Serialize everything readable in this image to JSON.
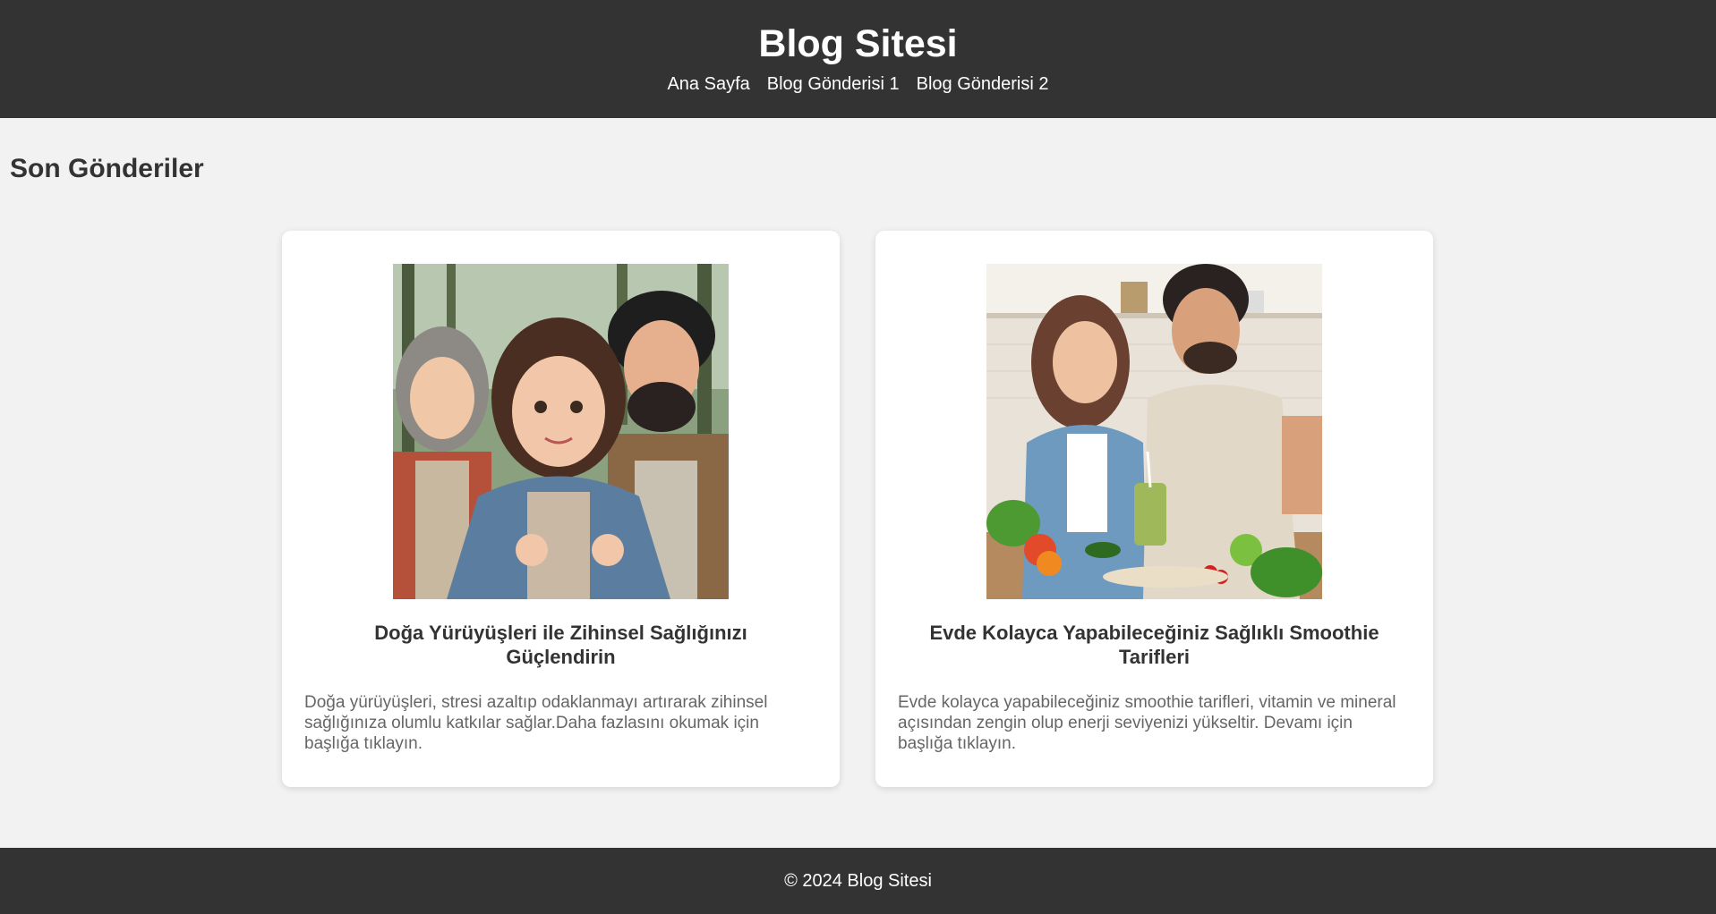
{
  "header": {
    "title": "Blog Sitesi",
    "nav": [
      {
        "label": "Ana Sayfa"
      },
      {
        "label": "Blog Gönderisi 1"
      },
      {
        "label": "Blog Gönderisi 2"
      }
    ]
  },
  "main": {
    "section_title": "Son Gönderiler",
    "posts": [
      {
        "title": "Doğa Yürüyüşleri ile Zihinsel Sağlığınızı Güçlendirin",
        "excerpt": "Doğa yürüyüşleri, stresi azaltıp odaklanmayı artırarak zihinsel sağlığınıza olumlu katkılar sağlar.Daha fazlasını okumak için başlığa tıklayın.",
        "image_alt": "illustration-hikers-in-forest"
      },
      {
        "title": "Evde Kolayca Yapabileceğiniz Sağlıklı Smoothie Tarifleri",
        "excerpt": "Evde kolayca yapabileceğiniz smoothie tarifleri, vitamin ve mineral açısından zengin olup enerji seviyenizi yükseltir. Devamı için başlığa tıklayın.",
        "image_alt": "photo-couple-making-smoothie"
      }
    ]
  },
  "footer": {
    "text": "© 2024 Blog Sitesi"
  },
  "colors": {
    "header_bg": "#333333",
    "page_bg": "#f2f2f2",
    "card_bg": "#ffffff",
    "text": "#333333",
    "muted_text": "#666666"
  }
}
